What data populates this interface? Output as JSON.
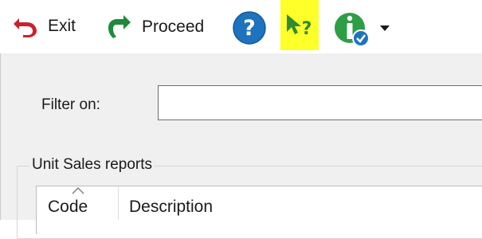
{
  "toolbar": {
    "exit_label": "Exit",
    "exit_icon": "undo-arrow-icon",
    "proceed_label": "Proceed",
    "proceed_icon": "proceed-arrow-icon",
    "help_icon": "question-mark-icon",
    "whats_this_icon": "whats-this-pointer-icon",
    "info_icon": "info-icon",
    "colors": {
      "exit": "#c8232c",
      "proceed": "#1f8a3a",
      "help": "#1e73be",
      "highlight": "#ffff2a",
      "info": "#2e9e46"
    }
  },
  "filter": {
    "label": "Filter on:",
    "value": ""
  },
  "unit_sales": {
    "title": "Unit Sales reports",
    "columns": [
      "Code",
      "Description"
    ]
  }
}
